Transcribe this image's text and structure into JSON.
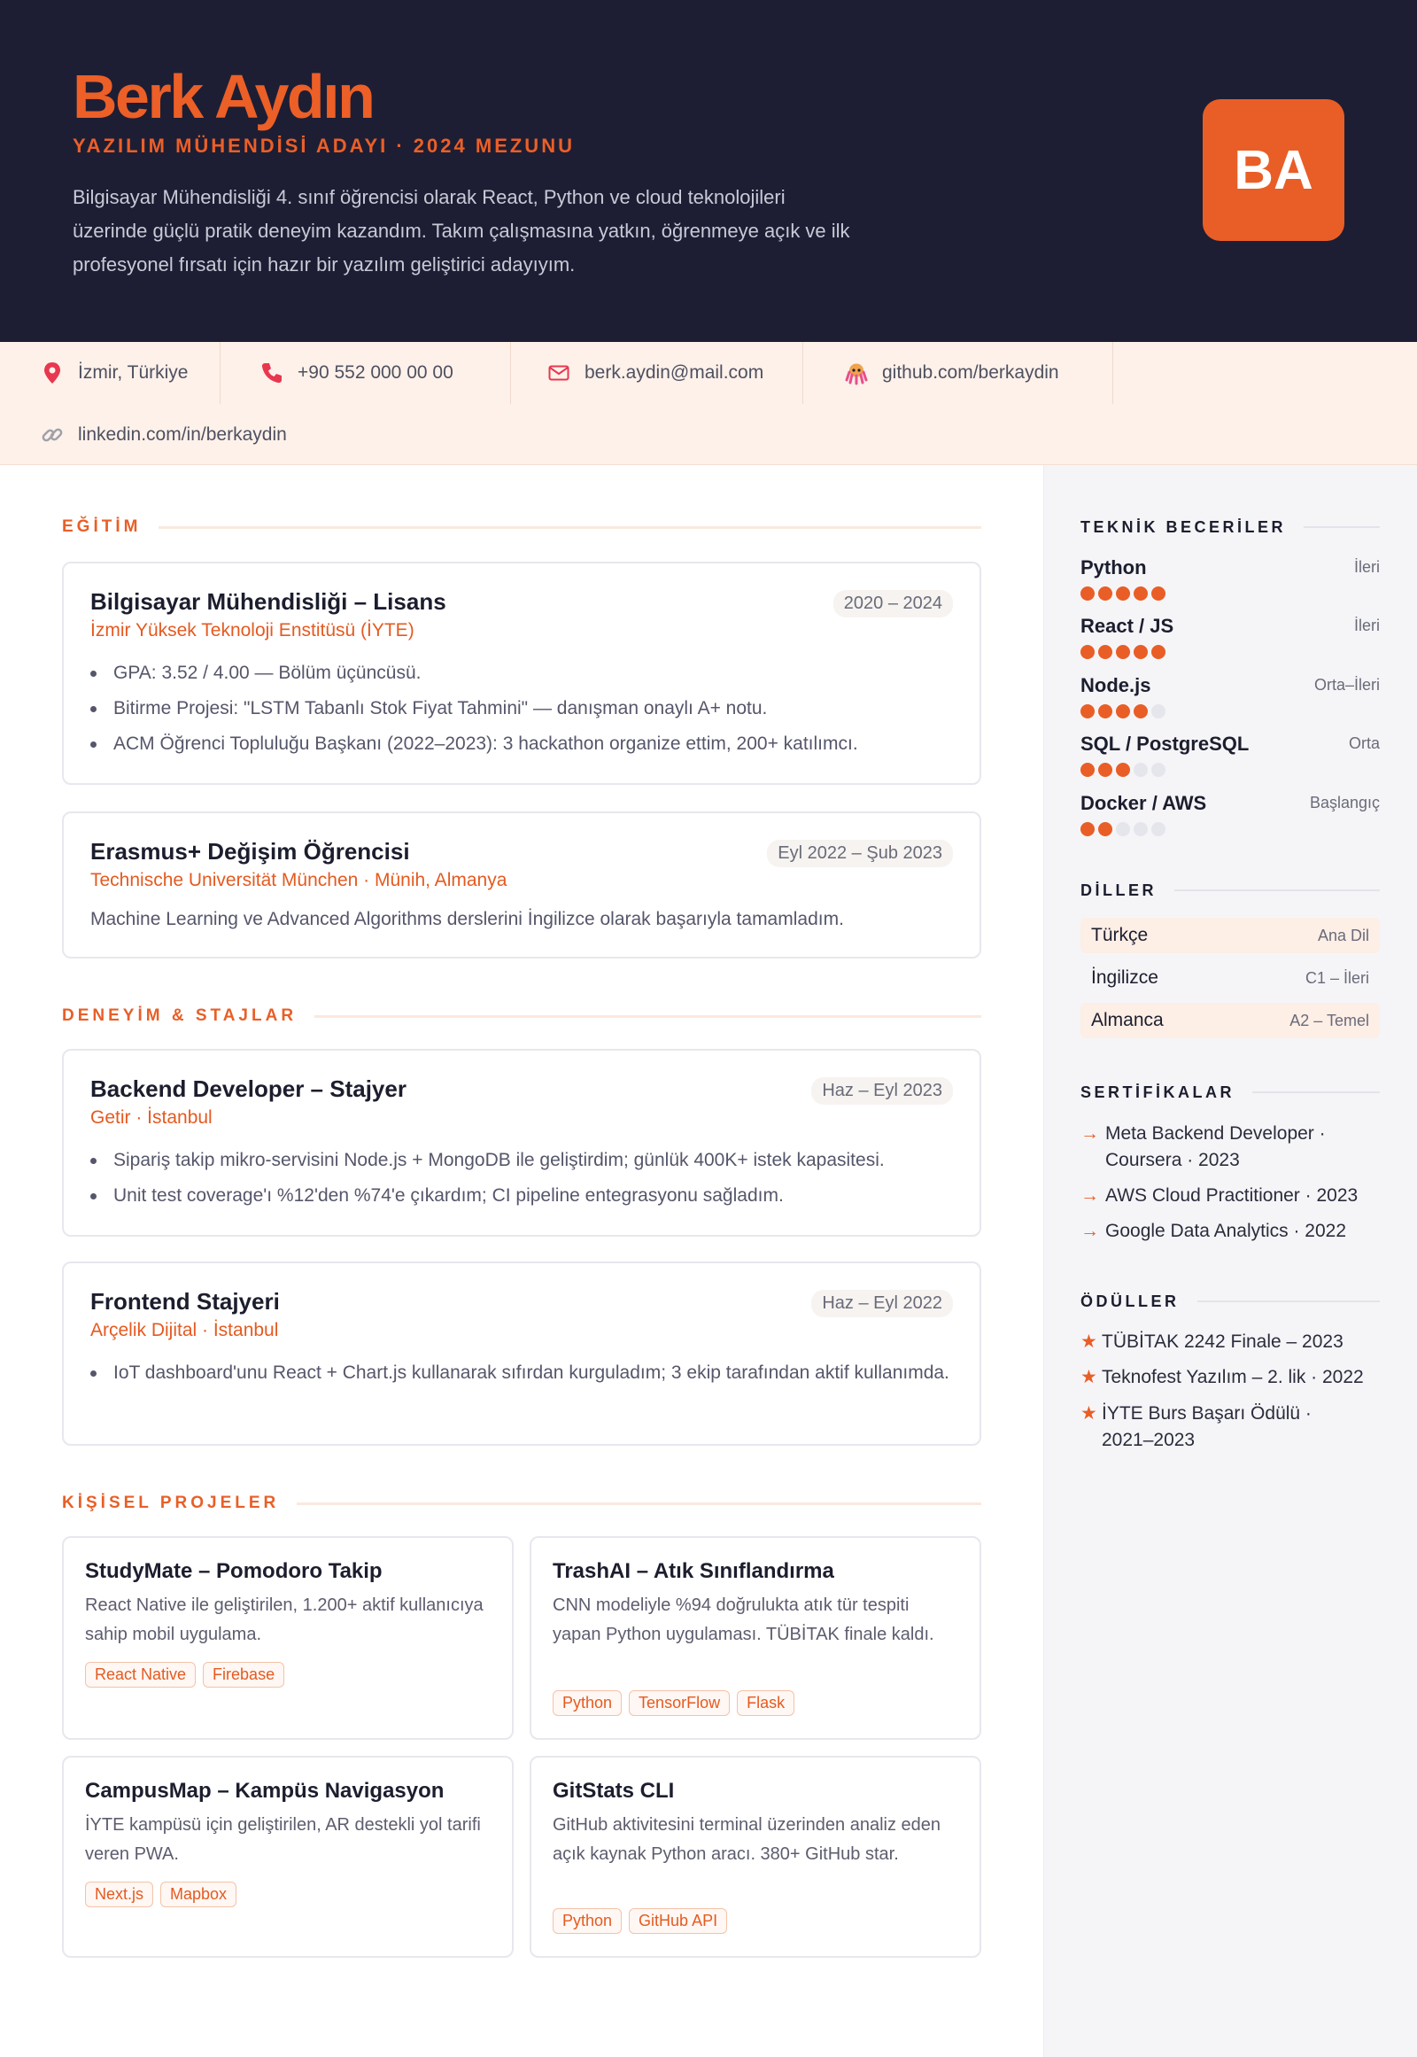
{
  "header": {
    "name": "Berk Aydın",
    "subtitle": "YAZILIM MÜHENDİSİ ADAYI · 2024 MEZUNU",
    "summary": "Bilgisayar Mühendisliği 4. sınıf öğrencisi olarak React, Python ve cloud teknolojileri üzerinde güçlü pratik deneyim kazandım. Takım çalışmasına yatkın, öğrenmeye açık ve ilk profesyonel fırsatı için hazır bir yazılım geliştirici adayıyım.",
    "initials": "BA"
  },
  "contact": {
    "location": "İzmir, Türkiye",
    "phone": "+90 552 000 00 00",
    "email": "berk.aydin@mail.com",
    "github": "github.com/berkaydin",
    "linkedin": "linkedin.com/in/berkaydin"
  },
  "sections": {
    "education": "EĞİTİM",
    "experience": "DENEYİM & STAJLAR",
    "projects": "KİŞİSEL PROJELER",
    "skills": "TEKNİK BECERİLER",
    "languages": "DİLLER",
    "certificates": "SERTİFİKALAR",
    "awards": "ÖDÜLLER"
  },
  "education": [
    {
      "title": "Bilgisayar Mühendisliği – Lisans",
      "org": "İzmir Yüksek Teknoloji Enstitüsü (İYTE)",
      "date": "2020 – 2024",
      "bullets": [
        "GPA: 3.52 / 4.00 — Bölüm üçüncüsü.",
        "Bitirme Projesi: \"LSTM Tabanlı Stok Fiyat Tahmini\" — danışman onaylı A+ notu.",
        "ACM Öğrenci Topluluğu Başkanı (2022–2023): 3 hackathon organize ettim, 200+ katılımcı."
      ]
    },
    {
      "title": "Erasmus+ Değişim Öğrencisi",
      "org": "Technische Universität München · Münih, Almanya",
      "date": "Eyl 2022 – Şub 2023",
      "desc": "Machine Learning ve Advanced Algorithms derslerini İngilizce olarak başarıyla tamamladım."
    }
  ],
  "experience": [
    {
      "title": "Backend Developer – Stajyer",
      "org": "Getir · İstanbul",
      "date": "Haz – Eyl 2023",
      "bullets": [
        "Sipariş takip mikro-servisini Node.js + MongoDB ile geliştirdim; günlük 400K+ istek kapasitesi.",
        "Unit test coverage'ı %12'den %74'e çıkardım; CI pipeline entegrasyonu sağladım."
      ]
    },
    {
      "title": "Frontend Stajyeri",
      "org": "Arçelik Dijital · İstanbul",
      "date": "Haz – Eyl 2022",
      "bullets": [
        "IoT dashboard'unu React + Chart.js kullanarak sıfırdan kurguladım; 3 ekip tarafından aktif kullanımda."
      ]
    }
  ],
  "projects": [
    {
      "title": "StudyMate – Pomodoro Takip",
      "desc": "React Native ile geliştirilen, 1.200+ aktif kullanıcıya sahip mobil uygulama.",
      "tags": [
        "React Native",
        "Firebase"
      ]
    },
    {
      "title": "TrashAI – Atık Sınıflandırma",
      "desc": "CNN modeliyle %94 doğrulukta atık tür tespiti yapan Python uygulaması. TÜBİTAK finale kaldı.",
      "tags": [
        "Python",
        "TensorFlow",
        "Flask"
      ]
    },
    {
      "title": "CampusMap – Kampüs Navigasyon",
      "desc": "İYTE kampüsü için geliştirilen, AR destekli yol tarifi veren PWA.",
      "tags": [
        "Next.js",
        "Mapbox"
      ]
    },
    {
      "title": "GitStats CLI",
      "desc": "GitHub aktivitesini terminal üzerinden analiz eden açık kaynak Python aracı. 380+ GitHub star.",
      "tags": [
        "Python",
        "GitHub API"
      ]
    }
  ],
  "skills": [
    {
      "name": "Python",
      "level": "İleri",
      "rating": 5
    },
    {
      "name": "React / JS",
      "level": "İleri",
      "rating": 5
    },
    {
      "name": "Node.js",
      "level": "Orta–İleri",
      "rating": 4
    },
    {
      "name": "SQL / PostgreSQL",
      "level": "Orta",
      "rating": 3
    },
    {
      "name": "Docker / AWS",
      "level": "Başlangıç",
      "rating": 2
    }
  ],
  "languages": [
    {
      "name": "Türkçe",
      "level": "Ana Dil"
    },
    {
      "name": "İngilizce",
      "level": "C1 – İleri"
    },
    {
      "name": "Almanca",
      "level": "A2 – Temel"
    }
  ],
  "certificates": [
    "Meta Backend Developer · Coursera · 2023",
    "AWS Cloud Practitioner · 2023",
    "Google Data Analytics · 2022"
  ],
  "awards": [
    "TÜBİTAK 2242 Finale – 2023",
    "Teknofest Yazılım – 2. lik · 2022",
    "İYTE Burs Başarı Ödülü · 2021–2023"
  ],
  "colors": {
    "accent": "#e95e26",
    "header_bg": "#1d1e34",
    "contact_bg": "#fdf1ea",
    "sidebar_bg": "#f5f5f8"
  },
  "icons": {
    "location": "map-pin-icon",
    "phone": "phone-icon",
    "email": "mail-icon",
    "github": "octopus-icon",
    "linkedin": "link-icon"
  }
}
